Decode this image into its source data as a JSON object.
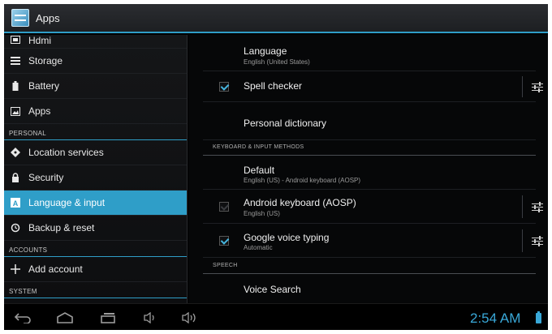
{
  "action_bar": {
    "title": "Apps",
    "icon": "settings-app-icon"
  },
  "sidebar": {
    "items": [
      {
        "label": "Hdmi",
        "icon": "hdmi-icon"
      },
      {
        "label": "Storage",
        "icon": "storage-icon"
      },
      {
        "label": "Battery",
        "icon": "battery-icon"
      },
      {
        "label": "Apps",
        "icon": "apps-icon"
      },
      {
        "header": "PERSONAL"
      },
      {
        "label": "Location services",
        "icon": "location-icon"
      },
      {
        "label": "Security",
        "icon": "lock-icon"
      },
      {
        "label": "Language & input",
        "icon": "language-icon",
        "selected": true
      },
      {
        "label": "Backup & reset",
        "icon": "backup-icon"
      },
      {
        "header": "ACCOUNTS"
      },
      {
        "label": "Add account",
        "icon": "add-icon"
      },
      {
        "header": "SYSTEM"
      }
    ]
  },
  "main": {
    "language": {
      "title": "Language",
      "summary": "English (United States)"
    },
    "spell_checker": {
      "title": "Spell checker",
      "checked": true
    },
    "personal_dictionary": {
      "title": "Personal dictionary"
    },
    "keyboard_header": "KEYBOARD & INPUT METHODS",
    "default_ime": {
      "title": "Default",
      "summary": "English (US) - Android keyboard (AOSP)"
    },
    "android_keyboard": {
      "title": "Android keyboard (AOSP)",
      "summary": "English (US)",
      "checked": true,
      "enabled": false
    },
    "google_voice": {
      "title": "Google voice typing",
      "summary": "Automatic",
      "checked": true
    },
    "speech_header": "SPEECH",
    "voice_search": {
      "title": "Voice Search"
    }
  },
  "system_bar": {
    "time": "2:54 AM",
    "buttons": [
      "back-icon",
      "home-icon",
      "recent-apps-icon",
      "volume-down-icon",
      "volume-up-icon"
    ]
  },
  "colors": {
    "accent": "#2f9ec8",
    "clock": "#39a8d8",
    "background": "#000000"
  }
}
